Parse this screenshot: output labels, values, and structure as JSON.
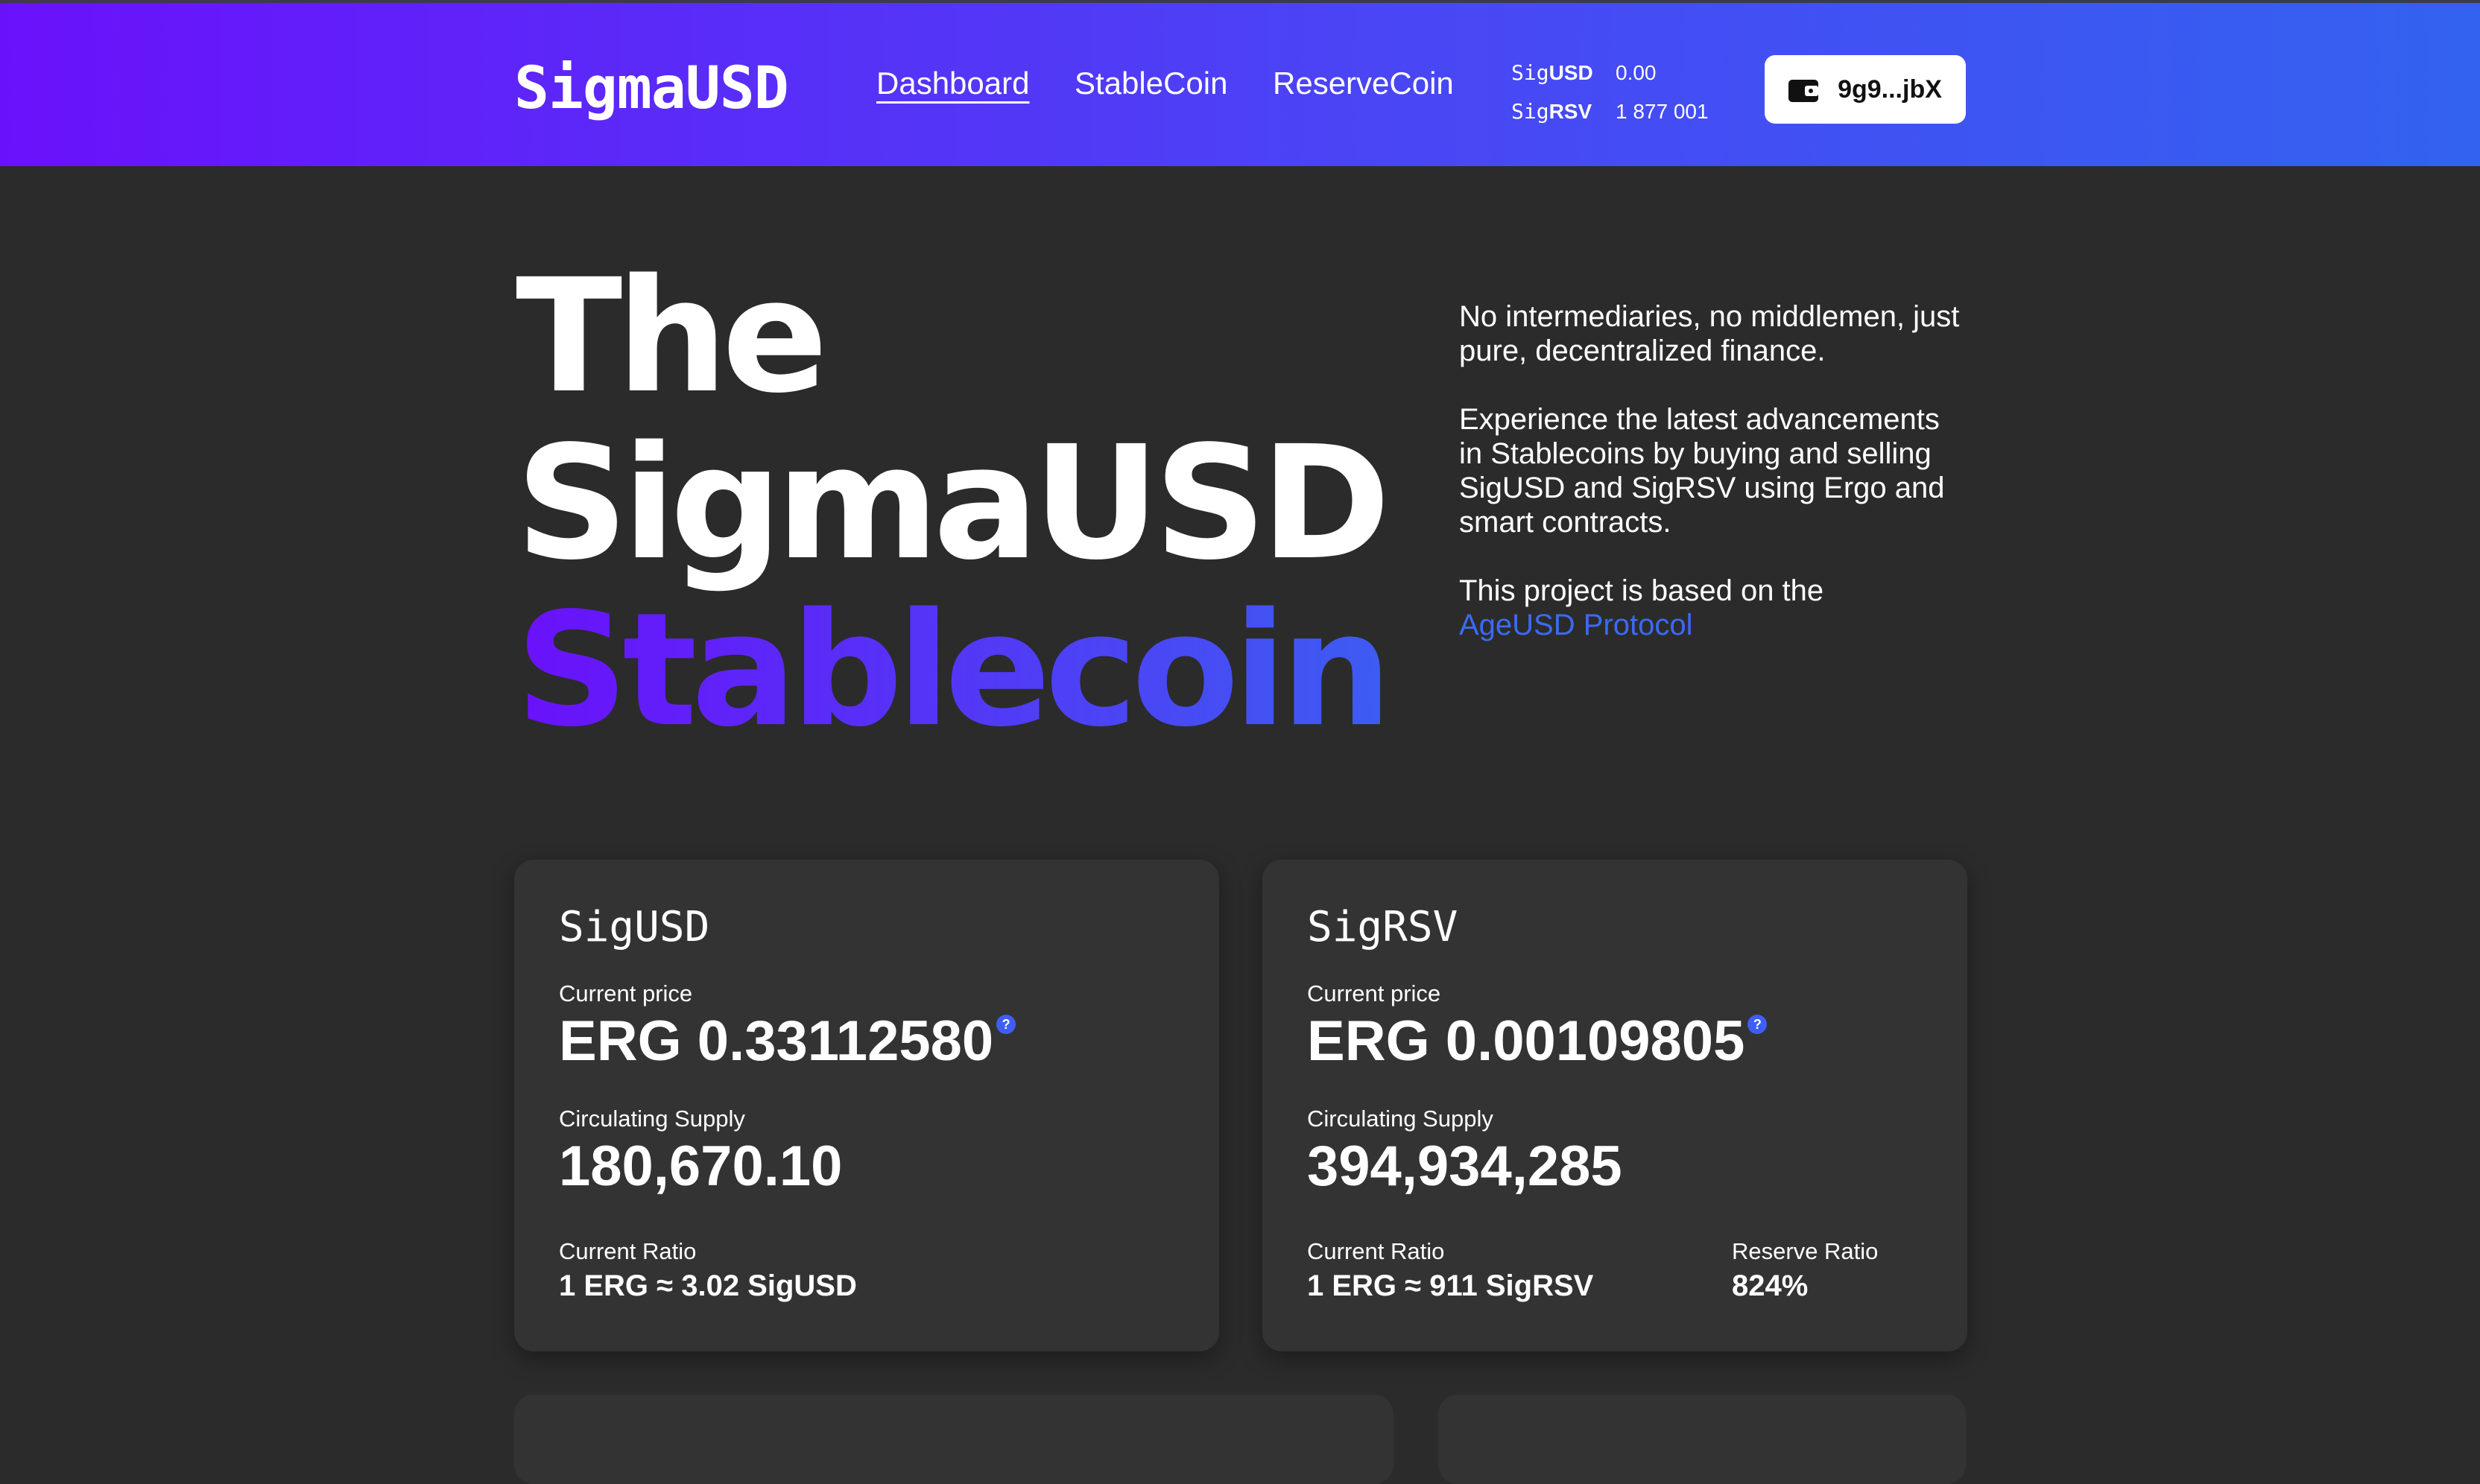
{
  "header": {
    "logo": "SigmaUSD",
    "nav": [
      "Dashboard",
      "StableCoin",
      "ReserveCoin"
    ],
    "balances": [
      {
        "prefix": "Sig",
        "suffix": "USD",
        "value": "0.00"
      },
      {
        "prefix": "Sig",
        "suffix": "RSV",
        "value": "1 877 001"
      }
    ],
    "wallet": {
      "address": "9g9...jbX",
      "icon": "wallet-icon"
    }
  },
  "hero": {
    "title_lines": [
      "The",
      "SigmaUSD",
      "Stablecoin"
    ],
    "paragraphs": [
      "No intermediaries, no middlemen, just pure, decentralized finance.",
      "Experience the latest advancements in Stablecoins by buying and selling SigUSD and SigRSV using Ergo and smart contracts.",
      "This project is based on the"
    ],
    "link": "AgeUSD Protocol"
  },
  "cards": [
    {
      "title": "SigUSD",
      "price_label": "Current price",
      "price": "ERG 0.33112580",
      "supply_label": "Circulating Supply",
      "supply": "180,670.10",
      "ratio_label": "Current Ratio",
      "ratio": "1 ERG ≈ 3.02 SigUSD"
    },
    {
      "title": "SigRSV",
      "price_label": "Current price",
      "price": "ERG 0.00109805",
      "supply_label": "Circulating Supply",
      "supply": "394,934,285",
      "ratio_label": "Current Ratio",
      "ratio": "1 ERG ≈ 911 SigRSV",
      "reserve_label": "Reserve Ratio",
      "reserve": "824%"
    }
  ],
  "colors": {
    "accent": "#3b6af5",
    "gradient_start": "#6a11fb",
    "gradient_end": "#3362f0",
    "background": "#2b2b2b",
    "card": "#333333"
  }
}
